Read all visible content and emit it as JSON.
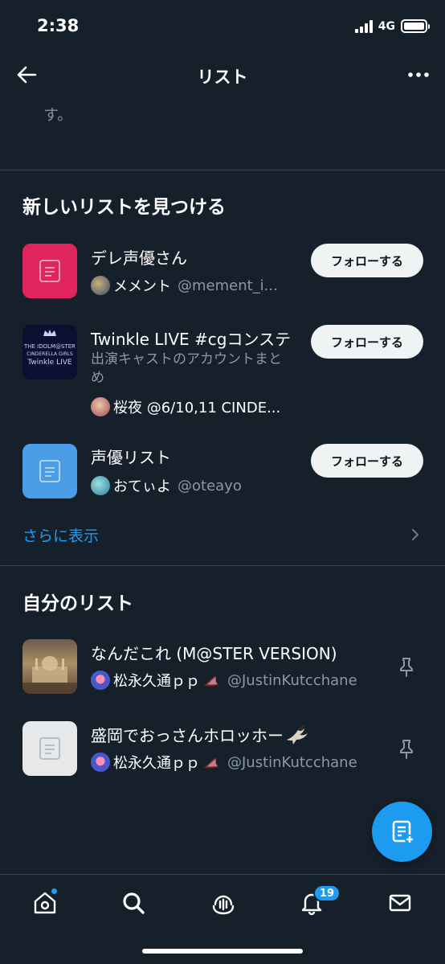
{
  "status_bar": {
    "time": "2:38",
    "network": "4G"
  },
  "header": {
    "title": "リスト"
  },
  "ghost_text": "す。",
  "discover": {
    "title": "新しいリストを見つける",
    "items": [
      {
        "title": "デレ声優さん",
        "owner_name": "メメント",
        "owner_handle": "@mement_i...",
        "follow_label": "フォローする",
        "thumb_color": "#e0245e"
      },
      {
        "title": "Twinkle LIVE #cgコンステ",
        "description": "出演キャストのアカウントまとめ",
        "owner_name": "桜夜 @6/10,11 CINDE...",
        "owner_handle": "",
        "follow_label": "フォローする",
        "thumb_text_top": "THE IDOLM@STER",
        "thumb_text_mid": "CINDERELLA GIRLS",
        "thumb_text_bot": "Twinkle LIVE"
      },
      {
        "title": "声優リスト",
        "owner_name": "おてぃよ",
        "owner_handle": "@oteayo",
        "follow_label": "フォローする",
        "thumb_color": "#4a9ee8"
      }
    ],
    "show_more": "さらに表示"
  },
  "my_lists": {
    "title": "自分のリスト",
    "items": [
      {
        "title": "なんだこれ (M@STER VERSION)",
        "owner_name": "松永久通ｐｐ",
        "owner_handle": "@JustinKutcchane"
      },
      {
        "title": "盛岡でおっさんホロッホー",
        "owner_name": "松永久通ｐｐ",
        "owner_handle": "@JustinKutcchane"
      }
    ]
  },
  "tab_bar": {
    "notifications_badge": "19"
  },
  "colors": {
    "background": "#15202b",
    "accent": "#1d9bf0",
    "secondary_text": "#8b98a5",
    "divider": "#38444d"
  }
}
